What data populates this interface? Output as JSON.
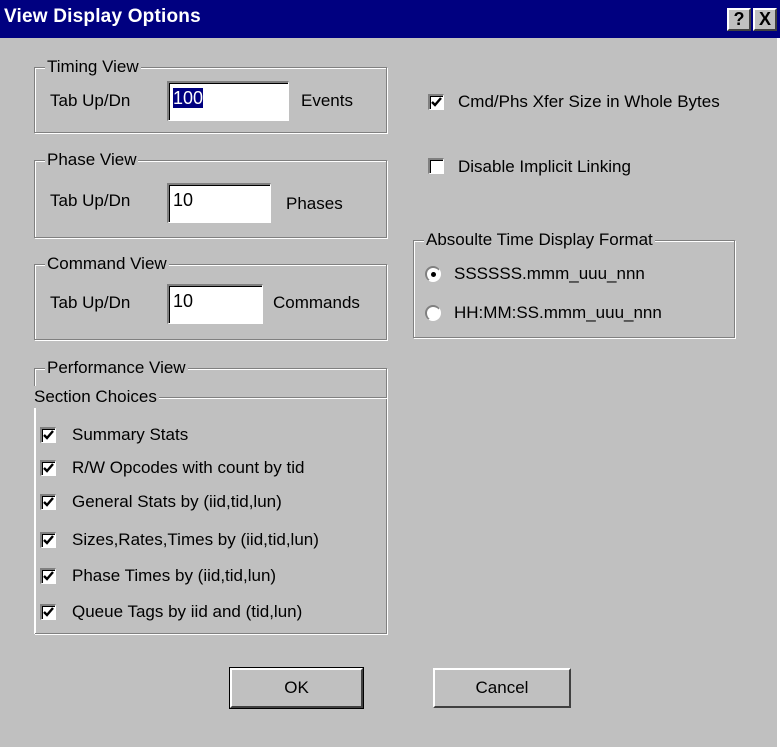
{
  "window": {
    "title": "View Display Options",
    "help_label": "?",
    "close_label": "X"
  },
  "timing_view": {
    "label": "Timing View",
    "tab_label": "Tab Up/Dn",
    "value": "100",
    "unit": "Events"
  },
  "phase_view": {
    "label": "Phase View",
    "tab_label": "Tab Up/Dn",
    "value": "10",
    "unit": "Phases"
  },
  "command_view": {
    "label": "Command View",
    "tab_label": "Tab Up/Dn",
    "value": "10",
    "unit": "Commands"
  },
  "performance_view": {
    "label": "Performance View",
    "section_label": "Section Choices",
    "items": [
      {
        "label": "Summary Stats",
        "checked": true
      },
      {
        "label": "R/W Opcodes with count by tid",
        "checked": true
      },
      {
        "label": "General Stats by (iid,tid,lun)",
        "checked": true
      },
      {
        "label": "Sizes,Rates,Times by (iid,tid,lun)",
        "checked": true
      },
      {
        "label": "Phase Times by (iid,tid,lun)",
        "checked": true
      },
      {
        "label": "Queue Tags by iid and (tid,lun)",
        "checked": true
      }
    ]
  },
  "options": {
    "xfer_size_label": "Cmd/Phs Xfer Size in Whole Bytes",
    "xfer_size_checked": true,
    "implicit_linking_label": "Disable Implicit Linking",
    "implicit_linking_checked": false
  },
  "time_format": {
    "label": "Absoulte Time Display Format",
    "options": [
      {
        "label": "SSSSSS.mmm_uuu_nnn",
        "selected": true
      },
      {
        "label": "HH:MM:SS.mmm_uuu_nnn",
        "selected": false
      }
    ]
  },
  "buttons": {
    "ok": "OK",
    "cancel": "Cancel"
  }
}
